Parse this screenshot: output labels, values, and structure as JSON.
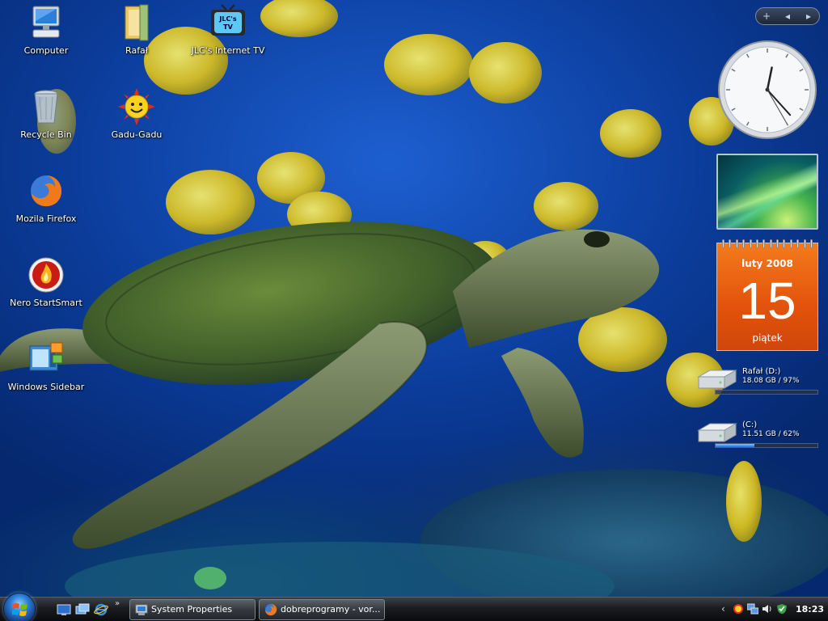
{
  "desktop": {
    "icons": [
      {
        "label": "Computer",
        "icon": "computer-icon"
      },
      {
        "label": "Rafał",
        "icon": "user-folder-icon"
      },
      {
        "label": "JLC's Internet TV",
        "icon": "tv-icon"
      },
      {
        "label": "Recycle Bin",
        "icon": "recycle-bin-icon"
      },
      {
        "label": "Gadu-Gadu",
        "icon": "sun-smiley-icon"
      },
      {
        "label": "Mozila Firefox",
        "icon": "firefox-icon"
      },
      {
        "label": "Nero StartSmart",
        "icon": "nero-icon"
      },
      {
        "label": "Windows Sidebar",
        "icon": "sidebar-icon"
      }
    ],
    "tv_icon_text_1": "JLC's",
    "tv_icon_text_2": "TV"
  },
  "sidebar": {
    "controls": {
      "add": "+",
      "prev": "◂",
      "next": "▸"
    },
    "clock": {
      "hour": 12,
      "minute": 23,
      "second": 25
    },
    "calendar": {
      "month": "luty 2008",
      "day": "15",
      "weekday": "piątek"
    },
    "drives": [
      {
        "name": "Rafał (D:)",
        "usage": "18.08 GB / 97%",
        "percent_free": 0
      },
      {
        "name": " (C:)",
        "usage": "11.51 GB / 62%",
        "percent_free": 38
      }
    ]
  },
  "taskbar": {
    "quick_launch": [
      "show-desktop-icon",
      "switch-windows-icon",
      "internet-explorer-icon"
    ],
    "more": "»",
    "tasks": [
      {
        "label": "System Properties",
        "icon": "system-properties-icon"
      },
      {
        "label": "dobreprogramy - vor...",
        "icon": "firefox-icon"
      }
    ],
    "tray": {
      "chevron": "‹",
      "icons": [
        "gadu-gadu-tray-icon",
        "network-tray-icon",
        "volume-icon",
        "security-shield-icon"
      ],
      "time": "18:23"
    }
  },
  "colors": {
    "calendar_orange": "#e9600f",
    "wallpaper_blue": "#0b3d9c",
    "drive_bar_fill": "#1f6fd6"
  }
}
